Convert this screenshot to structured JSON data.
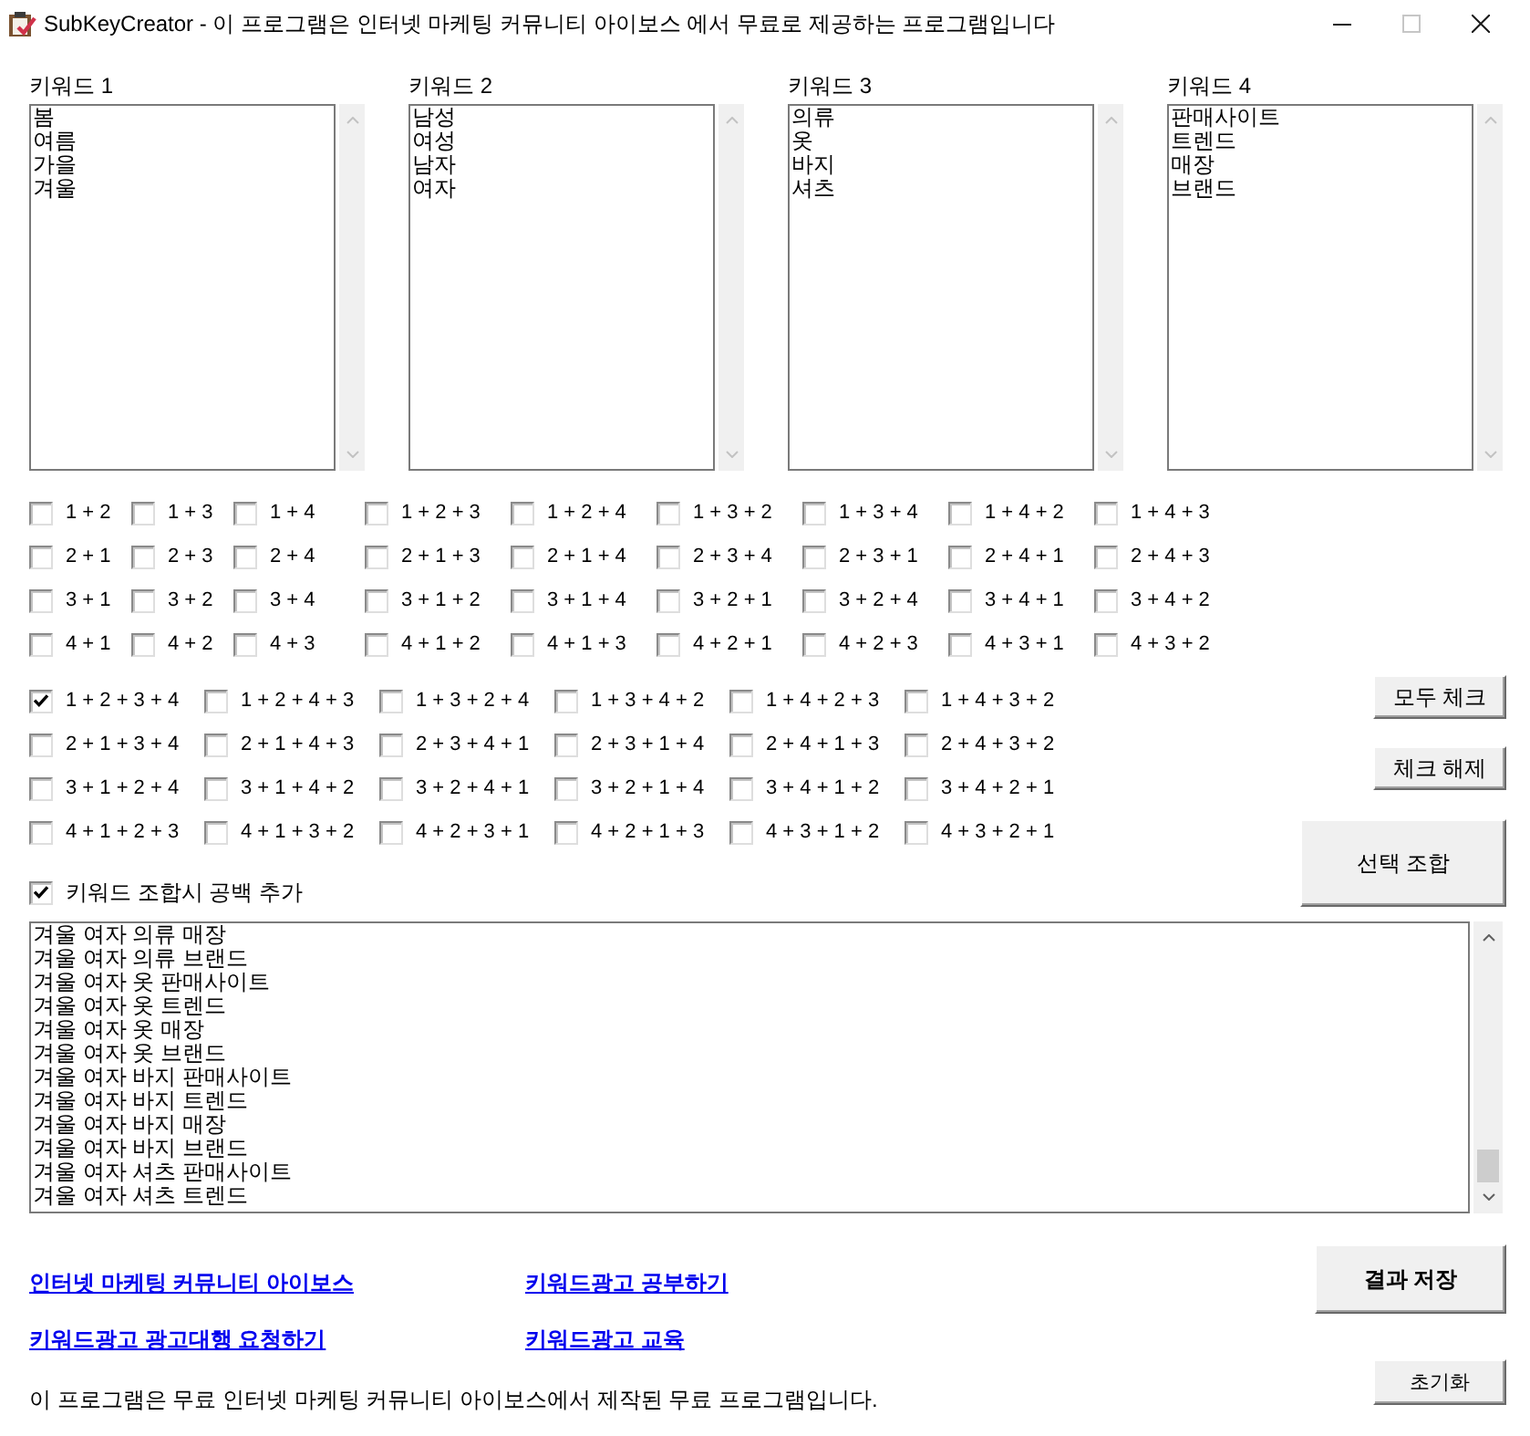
{
  "window": {
    "title": "SubKeyCreator - 이 프로그램은 인터넷 마케팅 커뮤니티 아이보스 에서 무료로 제공하는 프로그램입니다",
    "controls": [
      {
        "kind": "minimize",
        "disabled": false
      },
      {
        "kind": "maximize",
        "disabled": true
      },
      {
        "kind": "close",
        "disabled": false
      }
    ]
  },
  "keyword_lists": [
    {
      "label": "키워드 1",
      "items": [
        "봄",
        "여름",
        "가을",
        "겨울"
      ]
    },
    {
      "label": "키워드 2",
      "items": [
        "남성",
        "여성",
        "남자",
        "여자"
      ]
    },
    {
      "label": "키워드 3",
      "items": [
        "의류",
        "옷",
        "바지",
        "셔츠"
      ]
    },
    {
      "label": "키워드 4",
      "items": [
        "판매사이트",
        "트렌드",
        "매장",
        "브랜드"
      ]
    }
  ],
  "two_three_combinations": [
    [
      {
        "label": "1 + 2",
        "checked": false
      },
      {
        "label": "1 + 3",
        "checked": false
      },
      {
        "label": "1 + 4",
        "checked": false
      },
      {
        "label": "1 + 2 + 3",
        "checked": false
      },
      {
        "label": "1 + 2 + 4",
        "checked": false
      },
      {
        "label": "1 + 3 + 2",
        "checked": false
      },
      {
        "label": "1 + 3 + 4",
        "checked": false
      },
      {
        "label": "1 + 4 + 2",
        "checked": false
      },
      {
        "label": "1 + 4 + 3",
        "checked": false
      }
    ],
    [
      {
        "label": "2 + 1",
        "checked": false
      },
      {
        "label": "2 + 3",
        "checked": false
      },
      {
        "label": "2 + 4",
        "checked": false
      },
      {
        "label": "2 + 1 + 3",
        "checked": false
      },
      {
        "label": "2 + 1 + 4",
        "checked": false
      },
      {
        "label": "2 + 3 + 4",
        "checked": false
      },
      {
        "label": "2 + 3 + 1",
        "checked": false
      },
      {
        "label": "2 + 4 + 1",
        "checked": false
      },
      {
        "label": "2 + 4 + 3",
        "checked": false
      }
    ],
    [
      {
        "label": "3 + 1",
        "checked": false
      },
      {
        "label": "3 + 2",
        "checked": false
      },
      {
        "label": "3 + 4",
        "checked": false
      },
      {
        "label": "3 + 1 + 2",
        "checked": false
      },
      {
        "label": "3 + 1 + 4",
        "checked": false
      },
      {
        "label": "3 + 2 + 1",
        "checked": false
      },
      {
        "label": "3 + 2 + 4",
        "checked": false
      },
      {
        "label": "3 + 4 + 1",
        "checked": false
      },
      {
        "label": "3 + 4 + 2",
        "checked": false
      }
    ],
    [
      {
        "label": "4 + 1",
        "checked": false
      },
      {
        "label": "4 + 2",
        "checked": false
      },
      {
        "label": "4 + 3",
        "checked": false
      },
      {
        "label": "4 + 1 + 2",
        "checked": false
      },
      {
        "label": "4 + 1 + 3",
        "checked": false
      },
      {
        "label": "4 + 2 + 1",
        "checked": false
      },
      {
        "label": "4 + 2 + 3",
        "checked": false
      },
      {
        "label": "4 + 3 + 1",
        "checked": false
      },
      {
        "label": "4 + 3 + 2",
        "checked": false
      }
    ]
  ],
  "four_combinations": [
    [
      {
        "label": "1 + 2 + 3 + 4",
        "checked": true
      },
      {
        "label": "1 + 2 + 4 + 3",
        "checked": false
      },
      {
        "label": "1 + 3 + 2 + 4",
        "checked": false
      },
      {
        "label": "1 + 3 + 4 + 2",
        "checked": false
      },
      {
        "label": "1 + 4 + 2 + 3",
        "checked": false
      },
      {
        "label": "1 + 4 + 3 + 2",
        "checked": false
      }
    ],
    [
      {
        "label": "2 + 1 + 3 + 4",
        "checked": false
      },
      {
        "label": "2 + 1 + 4 + 3",
        "checked": false
      },
      {
        "label": "2 + 3 + 4 + 1",
        "checked": false
      },
      {
        "label": "2 + 3 + 1 + 4",
        "checked": false
      },
      {
        "label": "2 + 4 + 1 + 3",
        "checked": false
      },
      {
        "label": "2 + 4 + 3 + 2",
        "checked": false
      }
    ],
    [
      {
        "label": "3 + 1 + 2 + 4",
        "checked": false
      },
      {
        "label": "3 + 1 + 4 + 2",
        "checked": false
      },
      {
        "label": "3 + 2 + 4 + 1",
        "checked": false
      },
      {
        "label": "3 + 2 + 1 + 4",
        "checked": false
      },
      {
        "label": "3 + 4 + 1 + 2",
        "checked": false
      },
      {
        "label": "3 + 4 + 2 + 1",
        "checked": false
      }
    ],
    [
      {
        "label": "4 + 1 + 2 + 3",
        "checked": false
      },
      {
        "label": "4 + 1 + 3 + 2",
        "checked": false
      },
      {
        "label": "4 + 2 + 3 + 1",
        "checked": false
      },
      {
        "label": "4 + 2 + 1 + 3",
        "checked": false
      },
      {
        "label": "4 + 3 + 1 + 2",
        "checked": false
      },
      {
        "label": "4 + 3 + 2 + 1",
        "checked": false
      }
    ]
  ],
  "check_all_button": "모두 체크",
  "uncheck_button": "체크 해제",
  "combine_button": "선택 조합",
  "space_option": {
    "label": "키워드 조합시 공백 추가",
    "checked": true
  },
  "results": [
    "겨울 여자 의류 매장",
    "겨울 여자 의류 브랜드",
    "겨울 여자 옷 판매사이트",
    "겨울 여자 옷 트렌드",
    "겨울 여자 옷 매장",
    "겨울 여자 옷 브랜드",
    "겨울 여자 바지 판매사이트",
    "겨울 여자 바지 트렌드",
    "겨울 여자 바지 매장",
    "겨울 여자 바지 브랜드",
    "겨울 여자 셔츠 판매사이트",
    "겨울 여자 셔츠 트렌드"
  ],
  "links": [
    "인터넷 마케팅 커뮤니티 아이보스",
    "키워드광고 공부하기",
    "키워드광고 광고대행 요청하기",
    "키워드광고 교육"
  ],
  "save_button": "결과 저장",
  "reset_button": "초기화",
  "footer_text": "이 프로그램은 무료 인터넷 마케팅 커뮤니티 아이보스에서 제작된 무료 프로그램입니다."
}
